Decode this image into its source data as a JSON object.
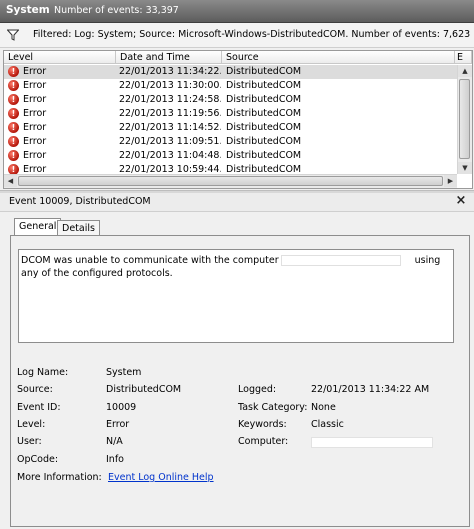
{
  "header": {
    "title": "System",
    "count": "Number of events: 33,397"
  },
  "filter": {
    "text": "Filtered: Log: System; Source: Microsoft-Windows-DistributedCOM. Number of events: 7,623"
  },
  "list": {
    "columns": [
      "Level",
      "Date and Time",
      "Source",
      "E"
    ],
    "rows": [
      {
        "level": "Error",
        "datetime": "22/01/2013 11:34:22...",
        "source": "DistributedCOM"
      },
      {
        "level": "Error",
        "datetime": "22/01/2013 11:30:00...",
        "source": "DistributedCOM"
      },
      {
        "level": "Error",
        "datetime": "22/01/2013 11:24:58...",
        "source": "DistributedCOM"
      },
      {
        "level": "Error",
        "datetime": "22/01/2013 11:19:56...",
        "source": "DistributedCOM"
      },
      {
        "level": "Error",
        "datetime": "22/01/2013 11:14:52...",
        "source": "DistributedCOM"
      },
      {
        "level": "Error",
        "datetime": "22/01/2013 11:09:51...",
        "source": "DistributedCOM"
      },
      {
        "level": "Error",
        "datetime": "22/01/2013 11:04:48...",
        "source": "DistributedCOM"
      },
      {
        "level": "Error",
        "datetime": "22/01/2013 10:59:44...",
        "source": "DistributedCOM"
      }
    ]
  },
  "detail": {
    "title": "Event 10009, DistributedCOM",
    "tabs": [
      "General",
      "Details"
    ],
    "description_before": "DCOM was unable to communicate with the computer",
    "description_after": "using any of the configured protocols.",
    "fields": {
      "log_name_label": "Log Name:",
      "log_name": "System",
      "source_label": "Source:",
      "source": "DistributedCOM",
      "logged_label": "Logged:",
      "logged": "22/01/2013 11:34:22 AM",
      "event_id_label": "Event ID:",
      "event_id": "10009",
      "task_category_label": "Task Category:",
      "task_category": "None",
      "level_label": "Level:",
      "level": "Error",
      "keywords_label": "Keywords:",
      "keywords": "Classic",
      "user_label": "User:",
      "user": "N/A",
      "computer_label": "Computer:",
      "opcode_label": "OpCode:",
      "opcode": "Info",
      "more_info_label": "More Information:",
      "more_info_link": "Event Log Online Help"
    }
  }
}
